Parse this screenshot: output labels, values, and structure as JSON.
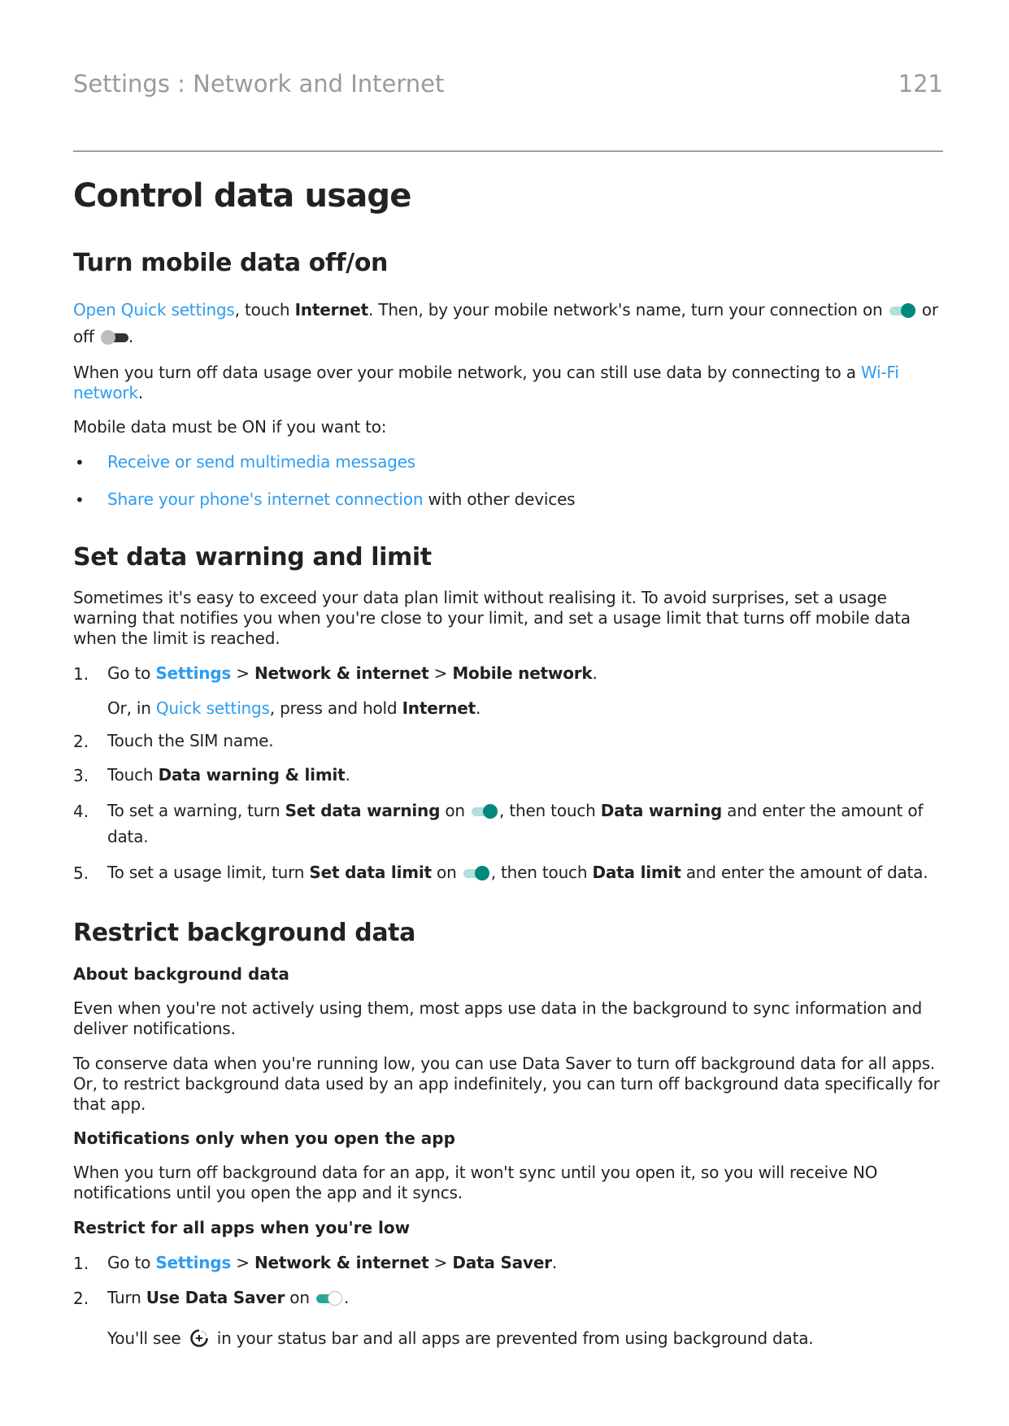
{
  "header": {
    "running_title": "Settings : Network and Internet",
    "page_number": "121"
  },
  "title": "Control data usage",
  "section1": {
    "heading": "Turn mobile data off/on",
    "p1": {
      "link": "Open Quick settings",
      "t1": ", touch ",
      "b1": "Internet",
      "t2": ". Then, by your mobile network's name, turn your connection on ",
      "t3": " or",
      "t4": "off ",
      "t5": "."
    },
    "p2": {
      "t1": "When you turn off data usage over your mobile network, you can still use data by connecting to a ",
      "link": "Wi-Fi network",
      "t2": "."
    },
    "p3": "Mobile data must be ON if you want to:",
    "bullets": [
      {
        "link": "Receive or send multimedia messages",
        "rest": ""
      },
      {
        "link": "Share your phone's internet connection",
        "rest": " with other devices"
      }
    ],
    "bullet_char": "•"
  },
  "section2": {
    "heading": "Set data warning and limit",
    "intro": "Sometimes it's easy to exceed your data plan limit without realising it. To avoid surprises, set a usage warning that notifies you when you're close to your limit, and set a usage limit that turns off mobile data when the limit is reached.",
    "steps": {
      "s1": {
        "num": "1.",
        "t1": "Go to ",
        "link": "Settings",
        "t2": " > ",
        "b1": "Network & internet",
        "t3": " > ",
        "b2": "Mobile network",
        "t4": "."
      },
      "s1_alt": {
        "t1": "Or, in ",
        "link": "Quick settings",
        "t2": ", press and hold ",
        "b1": "Internet",
        "t3": "."
      },
      "s2": {
        "num": "2.",
        "text": "Touch the SIM name."
      },
      "s3": {
        "num": "3.",
        "t1": "Touch ",
        "b1": "Data warning & limit",
        "t2": "."
      },
      "s4": {
        "num": "4.",
        "t1": "To set a warning, turn ",
        "b1": "Set data warning",
        "t2": " on ",
        "t3": ", then touch ",
        "b2": "Data warning",
        "t4": " and enter the amount of data."
      },
      "s5": {
        "num": "5.",
        "t1": "To set a usage limit, turn ",
        "b1": "Set data limit",
        "t2": " on ",
        "t3": ", then touch ",
        "b2": "Data limit",
        "t4": " and enter the amount of data."
      }
    }
  },
  "section3": {
    "heading": "Restrict background data",
    "sub1": "About background data",
    "p1": "Even when you're not actively using them, most apps use data in the background to sync information and deliver notifications.",
    "p2": "To conserve data when you're running low, you can use Data Saver to turn off background data for all apps. Or, to restrict background data used by an app indefinitely, you can turn off background data specifically for that app.",
    "sub2": "Notifications only when you open the app",
    "p3": "When you turn off background data for an app, it won't sync until you open it, so you will receive NO notifications until you open the app and it syncs.",
    "sub3": "Restrict for all apps when you're low",
    "steps": {
      "s1": {
        "num": "1.",
        "t1": "Go to ",
        "link": "Settings",
        "t2": " > ",
        "b1": "Network & internet",
        "t3": " > ",
        "b2": "Data Saver",
        "t4": "."
      },
      "s2": {
        "num": "2.",
        "t1": "Turn ",
        "b1": "Use Data Saver",
        "t2": " on ",
        "t3": "."
      },
      "note": {
        "t1": "You'll see ",
        "t2": " in your status bar and all apps are prevented from using background data."
      }
    }
  },
  "colors": {
    "link": "#2d9cf0",
    "toggle_on": "#00897b",
    "heading": "#222222",
    "running_head": "#9a9a9a"
  },
  "icons": {
    "toggle_on": "toggle-on-icon",
    "toggle_off": "toggle-off-icon",
    "data_saver": "data-saver-icon"
  }
}
